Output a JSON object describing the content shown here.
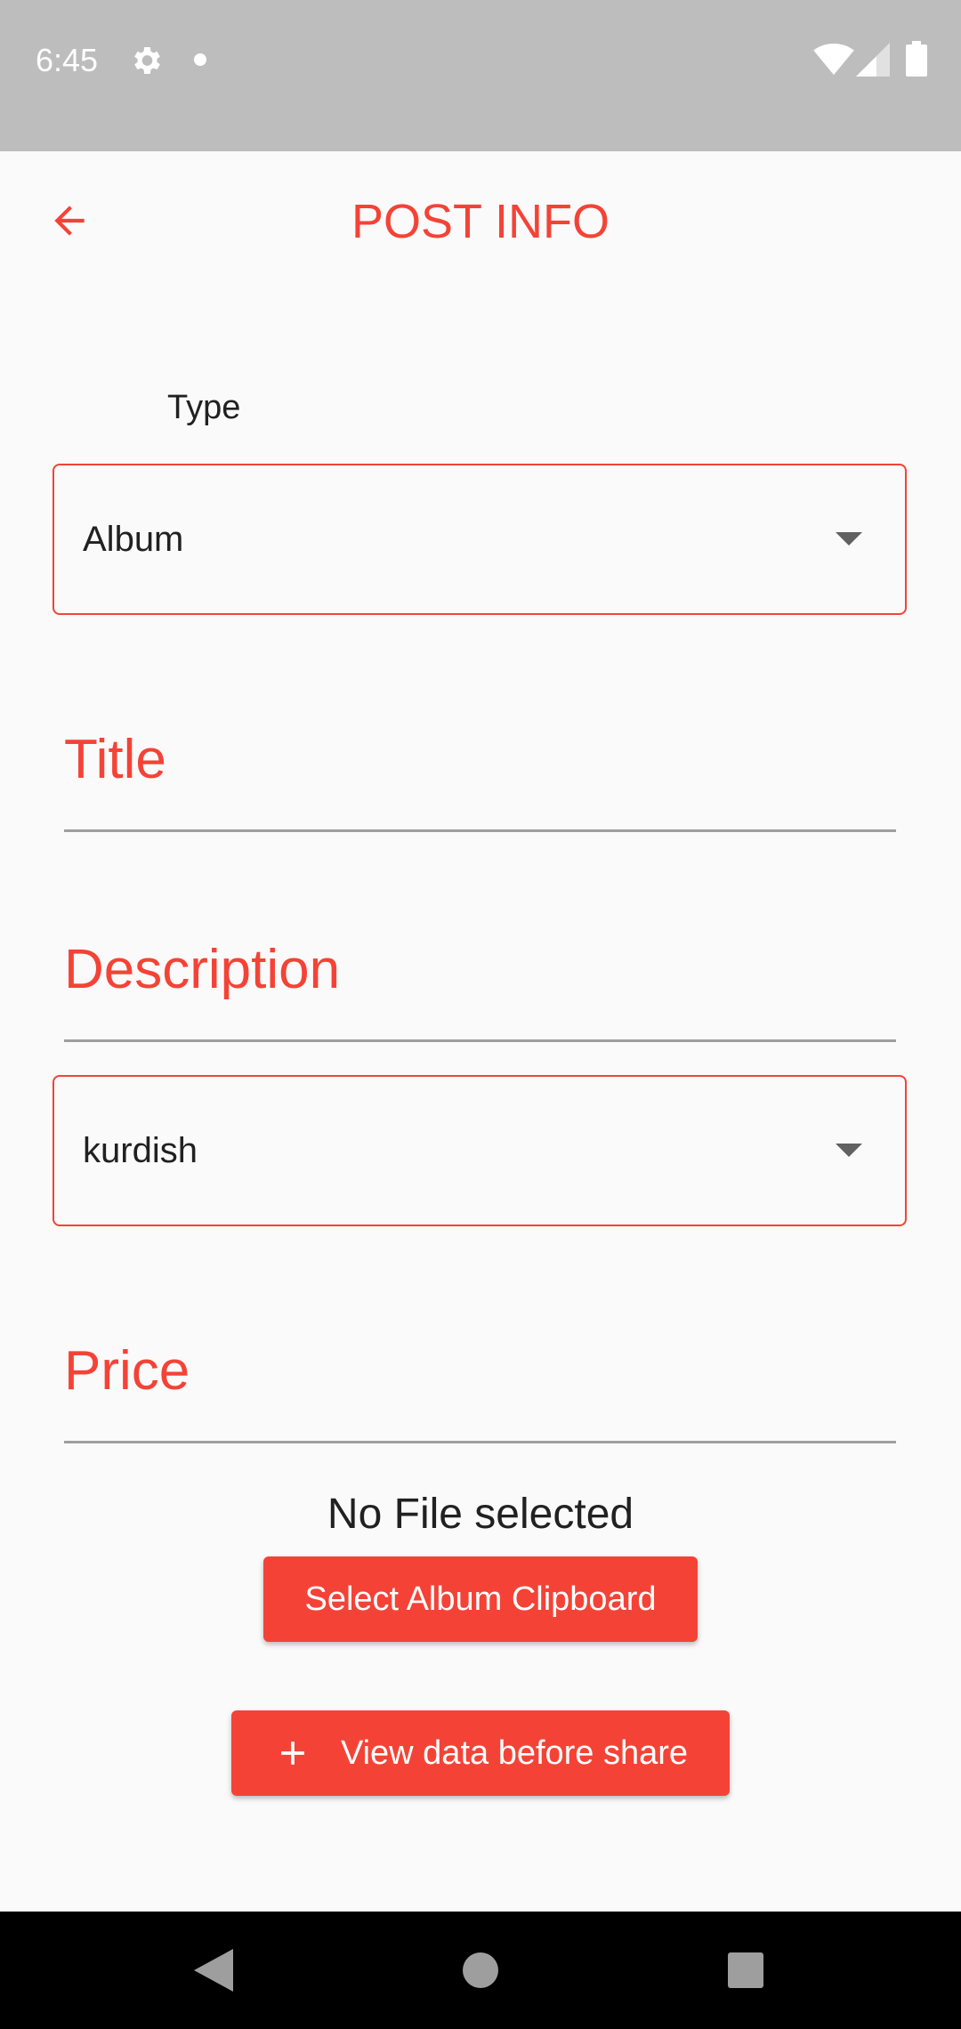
{
  "status_bar": {
    "time": "6:45",
    "icons": [
      "gear-icon",
      "notification-dot-icon",
      "wifi-icon",
      "signal-icon",
      "battery-icon"
    ]
  },
  "app_bar": {
    "title": "POST INFO",
    "back_icon": "arrow-back-icon"
  },
  "form": {
    "type_label": "Type",
    "type_value": "Album",
    "title_label": "Title",
    "description_label": "Description",
    "language_value": "kurdish",
    "price_label": "Price"
  },
  "file": {
    "status_text": "No File selected",
    "select_button_label": "Select Album Clipboard"
  },
  "actions": {
    "view_button_label": "View data before share",
    "view_button_icon": "plus-icon"
  },
  "nav_bar": {
    "icons": [
      "nav-back-icon",
      "nav-home-icon",
      "nav-recents-icon"
    ]
  },
  "colors": {
    "accent": "#f44336",
    "status_bar": "#bdbdbd",
    "background": "#fafafa",
    "nav_bar": "#000000"
  }
}
